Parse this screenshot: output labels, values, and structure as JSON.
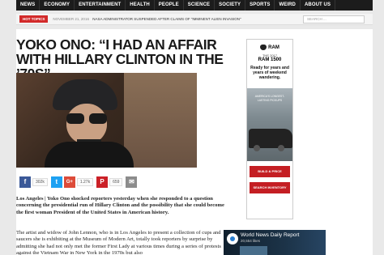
{
  "nav": {
    "items": [
      "News",
      "Economy",
      "Entertainment",
      "Health",
      "People",
      "Science",
      "Society",
      "Sports",
      "Weird",
      "About Us"
    ]
  },
  "subbar": {
    "hot_label": "HOT TOPICS",
    "date": "NOVEMBER 21, 2016",
    "ticker": "NASA ADMINISTRATOR SUSPENDED AFTER CLAIMS OF \"IMMINENT ALIEN INVASION\"",
    "search_placeholder": "SEARCH ..."
  },
  "article": {
    "title": "YOKO ONO: “I HAD AN AFFAIR WITH HILLARY CLINTON IN THE ’70S”",
    "share_counts": {
      "facebook": "302k",
      "google": "1.27k",
      "pinterest": "659"
    },
    "p1_lead": "Los Angeles | Yoko Ono shocked reporters yesterday when she responded to a question concerning the presidential run of Hillary Clinton and the possibility that she could become the first woman President of the United States in American history.",
    "p2": "The artist and widow of John Lennon, who is in Los Angeles to present a collection of cups and saucers she is exhibiting at the Museum of Modern Art, totally took reporters by surprise by admitting she had not only met the former First Lady at various times during a series of protests against the Vietnam War in New York in the 1970s but also"
  },
  "ad": {
    "brand": "RAM",
    "model_small": "THE 2017",
    "model_big": "RAM 1500",
    "tagline": "Ready for years and years of weekend wandering.",
    "award": "AMERICA'S LONGEST-LASTING PICKUPS",
    "cta_primary": "BUILD & PRICE",
    "cta_secondary": "SEARCH INVENTORY"
  },
  "video": {
    "title": "World News Daily Report",
    "views": "20,554 likes"
  },
  "colors": {
    "nav_bg": "#1c1c1c",
    "hot": "#d22a2a",
    "facebook": "#3b5998",
    "twitter": "#1da1f2",
    "google": "#dd4b39",
    "pinterest": "#cb2027",
    "email": "#8c8c8c",
    "ram_red": "#c41e23"
  }
}
